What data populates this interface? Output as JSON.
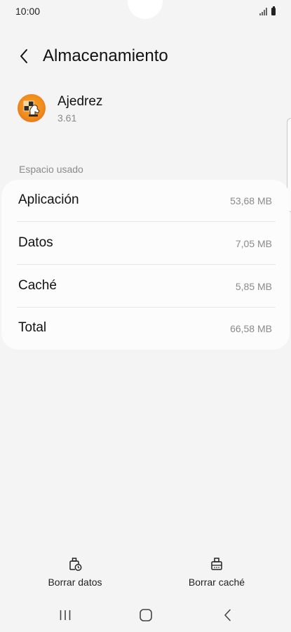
{
  "status_bar": {
    "time": "10:00"
  },
  "header": {
    "title": "Almacenamiento"
  },
  "app": {
    "name": "Ajedrez",
    "version": "3.61",
    "icon": "chess-app-icon"
  },
  "section_label": "Espacio usado",
  "storage_rows": [
    {
      "label": "Aplicación",
      "value": "53,68 MB"
    },
    {
      "label": "Datos",
      "value": "7,05 MB"
    },
    {
      "label": "Caché",
      "value": "5,85 MB"
    },
    {
      "label": "Total",
      "value": "66,58 MB"
    }
  ],
  "actions": {
    "clear_data": {
      "label": "Borrar datos",
      "icon": "clear-data-icon"
    },
    "clear_cache": {
      "label": "Borrar caché",
      "icon": "clear-cache-icon"
    }
  },
  "navigation": {
    "recents": "recents-icon",
    "home": "home-icon",
    "back": "back-icon"
  },
  "colors": {
    "background": "#f4f4f4",
    "card": "#fcfcfc",
    "secondary_text": "#8a8a8a",
    "app_icon_orange": "#f08c1c"
  }
}
